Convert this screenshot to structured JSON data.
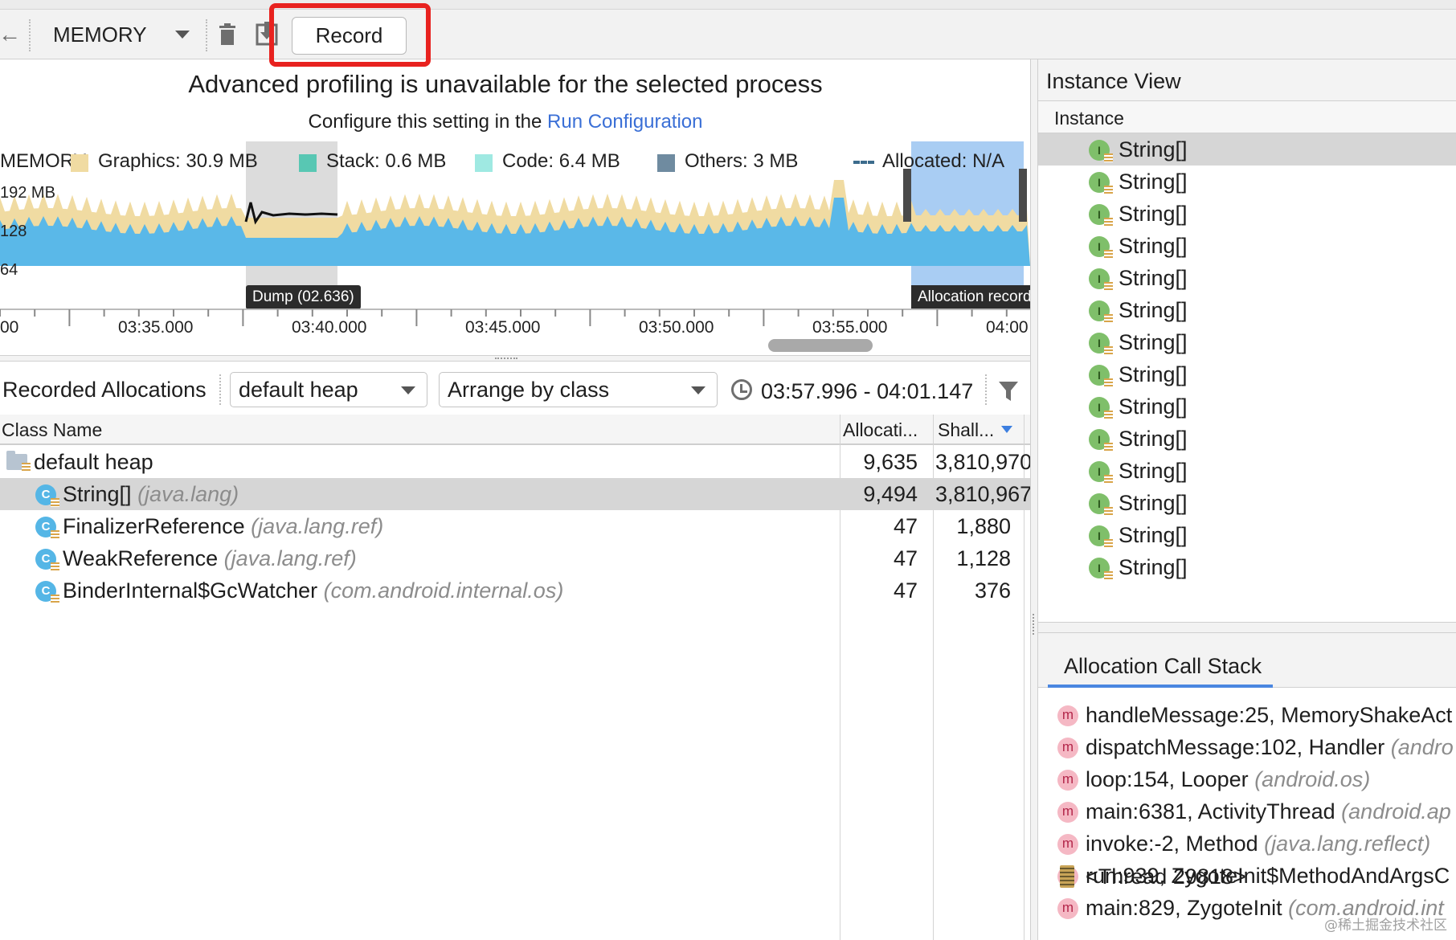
{
  "toolbar": {
    "profiler_label": "MEMORY",
    "record_label": "Record"
  },
  "banner": {
    "title": "Advanced profiling is unavailable for the selected process",
    "subtitle_prefix": "Configure this setting in the ",
    "subtitle_link": "Run Configuration"
  },
  "chart_data": {
    "type": "area",
    "title": "MEMORY",
    "ylabel": "192 MB",
    "y_ticks": [
      "192 MB",
      "128",
      "64"
    ],
    "x_ticks": [
      "00",
      "03:35.000",
      "03:40.000",
      "03:45.000",
      "03:50.000",
      "03:55.000",
      "04:00"
    ],
    "legend": [
      {
        "label": "Graphics: 30.9 MB",
        "color": "#f0dba2"
      },
      {
        "label": "Stack: 0.6 MB",
        "color": "#58c7b3"
      },
      {
        "label": "Code: 6.4 MB",
        "color": "#9fe9e2"
      },
      {
        "label": "Others: 3 MB",
        "color": "#6f8ba0"
      },
      {
        "label": "Allocated: N/A",
        "color": "#3c6c8c"
      }
    ],
    "markers": [
      "Dump (02.636)",
      "Allocation record"
    ],
    "series_colors": {
      "java": "#5ab8e8",
      "graphics": "#f0dba2",
      "selection": "#a9cdf3"
    }
  },
  "allocations": {
    "title": "Recorded Allocations",
    "heap_select": "default heap",
    "arrange_select": "Arrange by class",
    "range": "03:57.996 - 04:01.147",
    "columns": [
      "Class Name",
      "Allocati...",
      "Shall..."
    ],
    "root": {
      "name": "default heap",
      "allocations": "9,635",
      "shallow": "3,810,970"
    },
    "rows": [
      {
        "name": "String[]",
        "pkg": "(java.lang)",
        "allocations": "9,494",
        "shallow": "3,810,967"
      },
      {
        "name": "FinalizerReference",
        "pkg": "(java.lang.ref)",
        "allocations": "47",
        "shallow": "1,880"
      },
      {
        "name": "WeakReference",
        "pkg": "(java.lang.ref)",
        "allocations": "47",
        "shallow": "1,128"
      },
      {
        "name": "BinderInternal$GcWatcher",
        "pkg": "(com.android.internal.os)",
        "allocations": "47",
        "shallow": "376"
      }
    ]
  },
  "instance_view": {
    "title": "Instance View",
    "column": "Instance",
    "items": [
      "String[]",
      "String[]",
      "String[]",
      "String[]",
      "String[]",
      "String[]",
      "String[]",
      "String[]",
      "String[]",
      "String[]",
      "String[]",
      "String[]",
      "String[]",
      "String[]"
    ]
  },
  "call_stack": {
    "title": "Allocation Call Stack",
    "frames": [
      {
        "method": "handleMessage:25, MemoryShakeAct",
        "pkg": ""
      },
      {
        "method": "dispatchMessage:102, Handler ",
        "pkg": "(andro"
      },
      {
        "method": "loop:154, Looper ",
        "pkg": "(android.os)"
      },
      {
        "method": "main:6381, ActivityThread ",
        "pkg": "(android.ap"
      },
      {
        "method": "invoke:-2, Method ",
        "pkg": "(java.lang.reflect)"
      },
      {
        "method": "run:939, ZygoteInit$MethodAndArgsC",
        "pkg": ""
      },
      {
        "method": "main:829, ZygoteInit ",
        "pkg": "(com.android.int"
      }
    ],
    "thread": "<Thread 29818>"
  },
  "watermark": "@稀土掘金技术社区",
  "icons": {
    "back": "back-arrow-icon",
    "trash": "trash-icon",
    "save": "save-heap-dump-icon",
    "clock": "clock-icon",
    "filter": "filter-icon",
    "class": "class-icon",
    "instance": "instance-icon",
    "method": "method-icon",
    "thread": "thread-icon"
  }
}
